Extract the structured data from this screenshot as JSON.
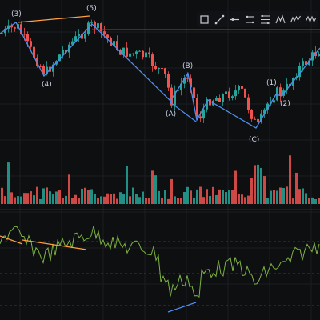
{
  "colors": {
    "background": "#0e0f11",
    "grid": "#1c1e22",
    "candle_up": "#26a69a",
    "candle_down": "#ef5350",
    "wave_line": "#4f8ff0",
    "trend_line": "#ff9f43",
    "rsi_line": "#7cb342",
    "label_text": "#c9d3e6",
    "reference_line": "#8a4a4a"
  },
  "toolbar": {
    "tools": [
      {
        "name": "window-icon"
      },
      {
        "name": "trend-line-icon"
      },
      {
        "name": "horizontal-ray-icon"
      },
      {
        "name": "parallel-channel-icon"
      },
      {
        "name": "fib-retracement-icon"
      },
      {
        "name": "pitchfork-icon"
      },
      {
        "name": "elliott-wave-icon"
      },
      {
        "name": "pattern-icon"
      }
    ]
  },
  "wave_labels": {
    "w3": "(3)",
    "w4": "(4)",
    "w5": "(5)",
    "wA": "(A)",
    "wB": "(B)",
    "wC": "(C)",
    "w1": "(1)",
    "w2": "(2)"
  },
  "panes": [
    "price",
    "volume",
    "oscillator"
  ]
}
